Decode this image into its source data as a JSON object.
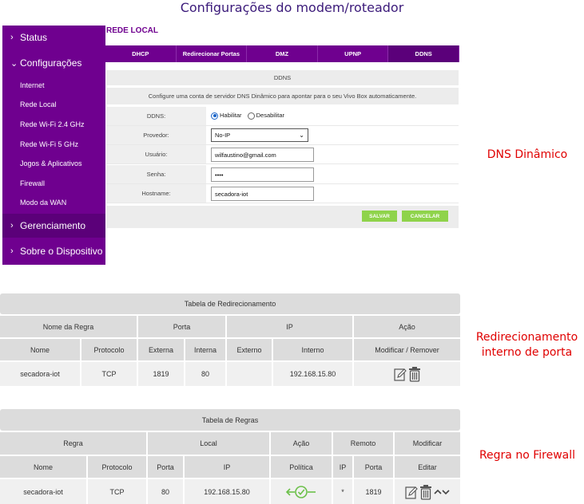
{
  "page_title": "Configurações do modem/roteador",
  "sidebar": {
    "status": "Status",
    "config": "Configurações",
    "items": [
      "Internet",
      "Rede Local",
      "Rede Wi-Fi 2.4 GHz",
      "Rede Wi-Fi 5 GHz",
      "Jogos & Aplicativos",
      "Firewall",
      "Modo da WAN"
    ],
    "gerenciamento": "Gerenciamento",
    "sobre": "Sobre o Dispositivo"
  },
  "section_label": "REDE LOCAL",
  "tabs": [
    "DHCP",
    "Redirecionar Portas",
    "DMZ",
    "UPNP",
    "DDNS"
  ],
  "ddns": {
    "header": "DDNS",
    "description": "Configure uma conta de servidor DNS Dinâmico para apontar para o seu Vivo Box automaticamente.",
    "labels": {
      "ddns": "DDNS:",
      "provedor": "Provedor:",
      "usuario": "Usuário:",
      "senha": "Senha:",
      "hostname": "Hostname:"
    },
    "radio_on": "Habilitar",
    "radio_off": "Desabilitar",
    "provedor_value": "No-IP",
    "usuario_value": "wilfaustino@gmail.com",
    "senha_value": "••••",
    "hostname_value": "secadora-iot",
    "save": "SALVAR",
    "cancel": "CANCELAR"
  },
  "captions": {
    "dns": "DNS Dinâmico",
    "redir_line1": "Redirecionamento",
    "redir_line2": "interno de porta",
    "firewall": "Regra no Firewall"
  },
  "redir_table": {
    "title": "Tabela de Redirecionamento",
    "groups": [
      "Nome da Regra",
      "Porta",
      "IP",
      "Ação"
    ],
    "cols": [
      "Nome",
      "Protocolo",
      "Externa",
      "Interna",
      "Externo",
      "Interno",
      "Modificar / Remover"
    ],
    "row": [
      "secadora-iot",
      "TCP",
      "1819",
      "80",
      "",
      "192.168.15.80"
    ]
  },
  "rules_table": {
    "title": "Tabela de Regras",
    "groups": [
      "Regra",
      "Local",
      "Ação",
      "Remoto",
      "Modificar"
    ],
    "cols": [
      "Nome",
      "Protocolo",
      "Porta",
      "IP",
      "Política",
      "IP",
      "Porta",
      "Editar"
    ],
    "row": [
      "secadora-iot",
      "TCP",
      "80",
      "192.168.15.80",
      "",
      "*",
      "1819"
    ]
  },
  "colors": {
    "brand_purple": "#6f008f",
    "button_green": "#8fd34b",
    "caption_red": "#e00000",
    "policy_green": "#6cc04a"
  },
  "icons": [
    "chevron-right-icon",
    "chevron-down-icon",
    "edit-icon",
    "trash-icon",
    "policy-accept-icon",
    "chevrons-updown-icon"
  ]
}
